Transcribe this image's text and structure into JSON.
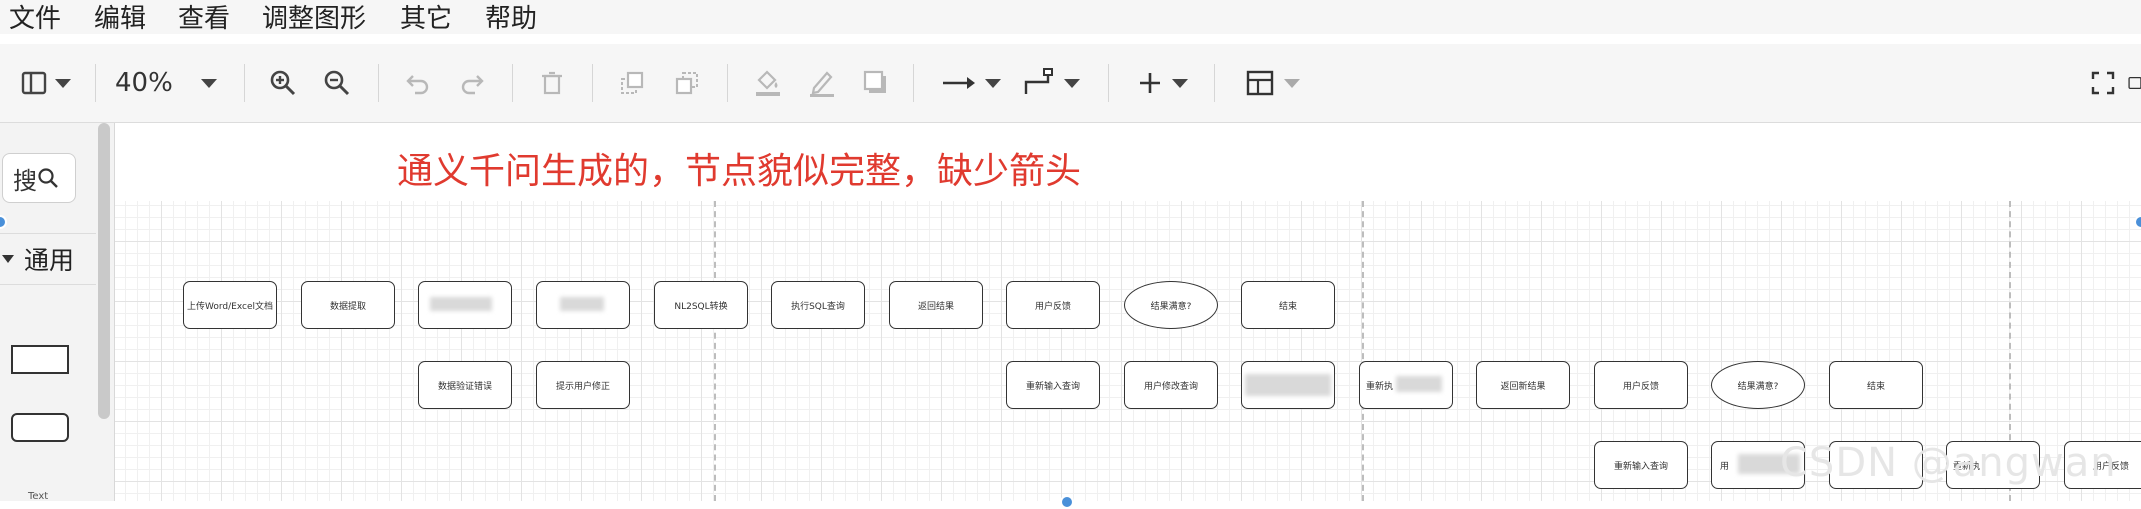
{
  "menu": [
    "文件",
    "编辑",
    "查看",
    "调整图形",
    "其它",
    "帮助"
  ],
  "toolbar": {
    "zoom": "40%"
  },
  "sidebar": {
    "search_label": "搜",
    "section": "通用",
    "text_shape_label": "Text"
  },
  "canvas": {
    "annotation": "通义千问生成的，节点貌似完整，缺少箭头",
    "row1": [
      "上传Word/Excel文档",
      "数据提取",
      "",
      "",
      "NL2SQL转换",
      "执行SQL查询",
      "返回结果",
      "用户反馈",
      "结果满意?",
      "结束"
    ],
    "row2a": [
      "数据验证错误",
      "提示用户修正"
    ],
    "row2b": [
      "重新输入查询",
      "用户修改查询",
      "",
      "重新执",
      "返回新结果",
      "用户反馈",
      "结果满意?",
      "结束"
    ],
    "row3": [
      "重新输入查询",
      "用",
      "",
      "重新执",
      "用户反馈"
    ],
    "watermark": "CSDN @angwan"
  }
}
